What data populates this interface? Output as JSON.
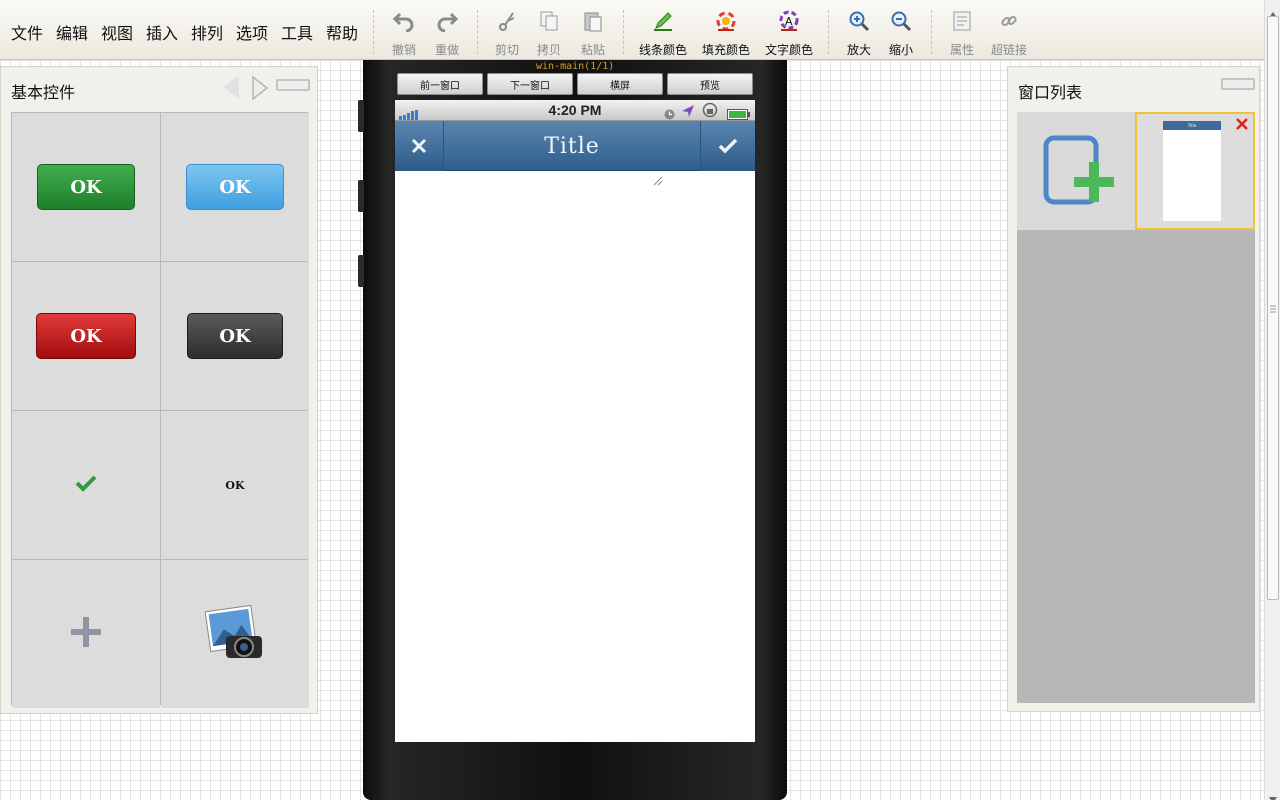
{
  "menu": [
    "文件",
    "编辑",
    "视图",
    "插入",
    "排列",
    "选项",
    "工具",
    "帮助"
  ],
  "toolbar": {
    "undo": "撤销",
    "redo": "重做",
    "cut": "剪切",
    "copy": "拷贝",
    "paste": "粘贴",
    "line_color": "线条颜色",
    "fill_color": "填充颜色",
    "text_color": "文字颜色",
    "zoom_in": "放大",
    "zoom_out": "缩小",
    "properties": "属性",
    "hyperlink": "超链接"
  },
  "left_panel": {
    "title": "基本控件",
    "widgets": {
      "ok_green": "OK",
      "ok_blue": "OK",
      "ok_red": "OK",
      "ok_dark": "OK",
      "ok_plain": "OK"
    }
  },
  "device": {
    "window_label": "win-main(1/1)",
    "nav": {
      "prev_window": "前一窗口",
      "next_window": "下一窗口",
      "landscape": "横屏",
      "preview": "预览"
    },
    "status_time": "4:20 PM",
    "app_title": "Title"
  },
  "right_panel": {
    "title": "窗口列表",
    "thumb_title": "Title"
  },
  "colors": {
    "titlebar": "#3d6c98",
    "selection": "#f1c233",
    "ok_green": "#2a9138",
    "ok_blue": "#55aee8",
    "ok_red": "#c11d1d",
    "ok_dark": "#3d3d3d"
  }
}
